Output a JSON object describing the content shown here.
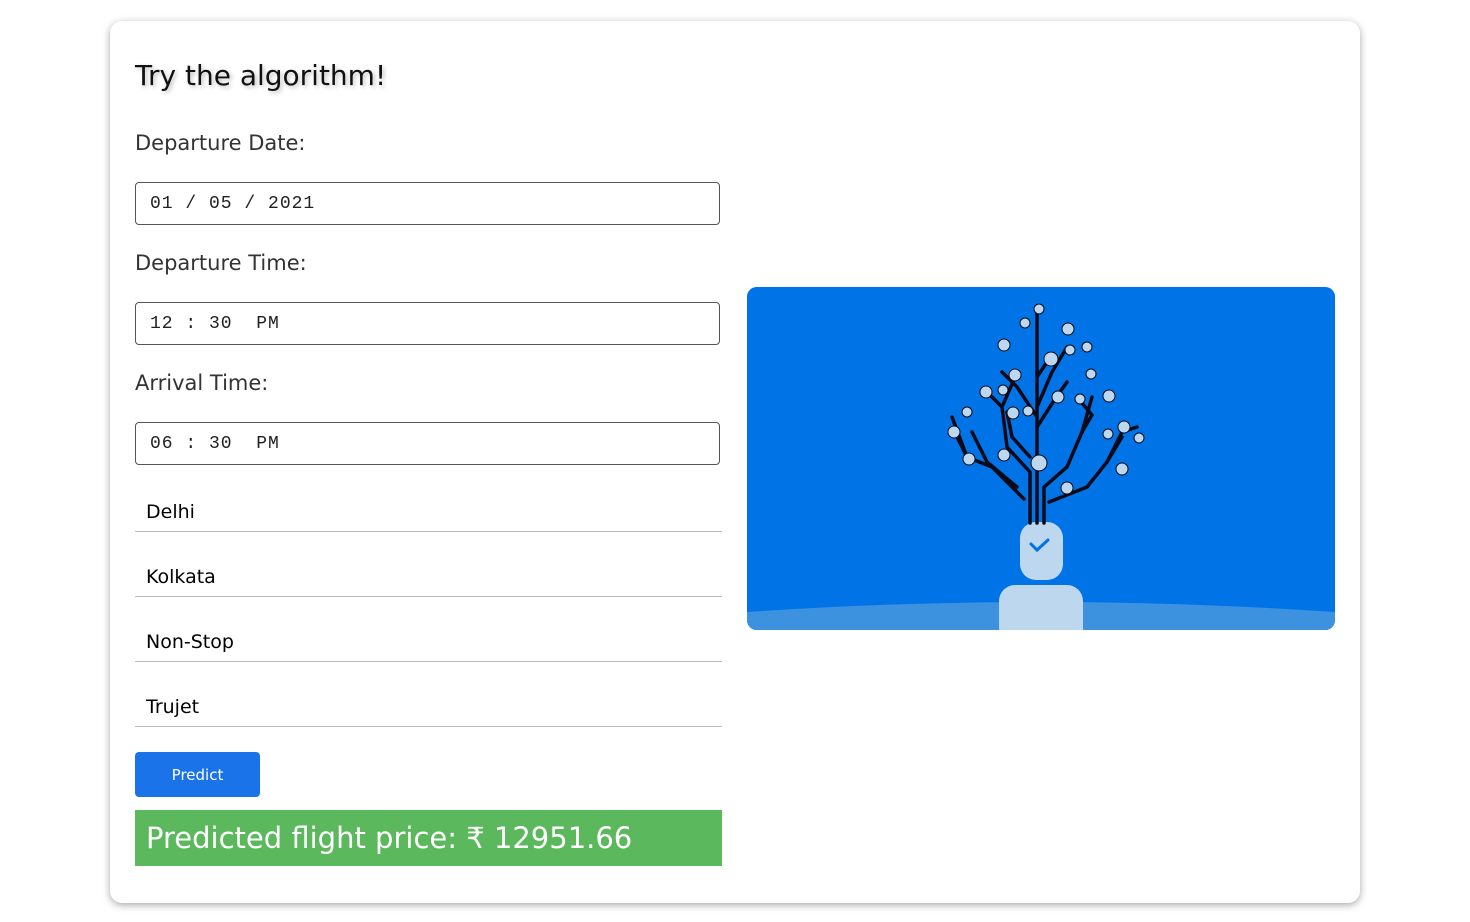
{
  "form": {
    "title": "Try the algorithm!",
    "departure_date_label": "Departure Date:",
    "departure_date_value": "01 / 05 / 2021",
    "departure_time_label": "Departure Time:",
    "departure_time_value": "12 : 30  PM",
    "arrival_time_label": "Arrival Time:",
    "arrival_time_value": "06 : 30  PM",
    "source": "Delhi",
    "destination": "Kolkata",
    "stops": "Non-Stop",
    "airline": "Trujet",
    "predict_label": "Predict",
    "result_label": "Predicted flight price: ₹ 12951.66"
  },
  "colors": {
    "accent": "#1a73e8",
    "result_bg": "#5cb85c",
    "illustration_bg": "#0073e6",
    "illustration_figure": "#bdd7ee"
  }
}
